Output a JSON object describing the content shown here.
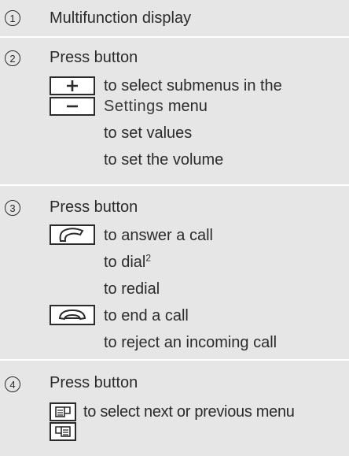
{
  "rows": [
    {
      "number": "1",
      "text": "Multifunction display"
    },
    {
      "number": "2",
      "intro": "Press button",
      "lines": [
        "to select submenus in the",
        "Settings",
        "menu",
        "to set values",
        "to set the volume"
      ],
      "keys": [
        "plus-key-icon",
        "minus-key-icon"
      ]
    },
    {
      "number": "3",
      "intro": "Press button",
      "lines": [
        "to answer a call",
        "to dial",
        "2",
        "to redial",
        "to end a call",
        "to reject an incoming call"
      ],
      "keys": [
        "phone-answer-key-icon",
        "phone-hangup-key-icon"
      ]
    },
    {
      "number": "4",
      "intro": "Press button",
      "lines": [
        "to select next or previous menu"
      ],
      "keys": [
        "menu-next-key-icon",
        "menu-previous-key-icon"
      ]
    }
  ]
}
